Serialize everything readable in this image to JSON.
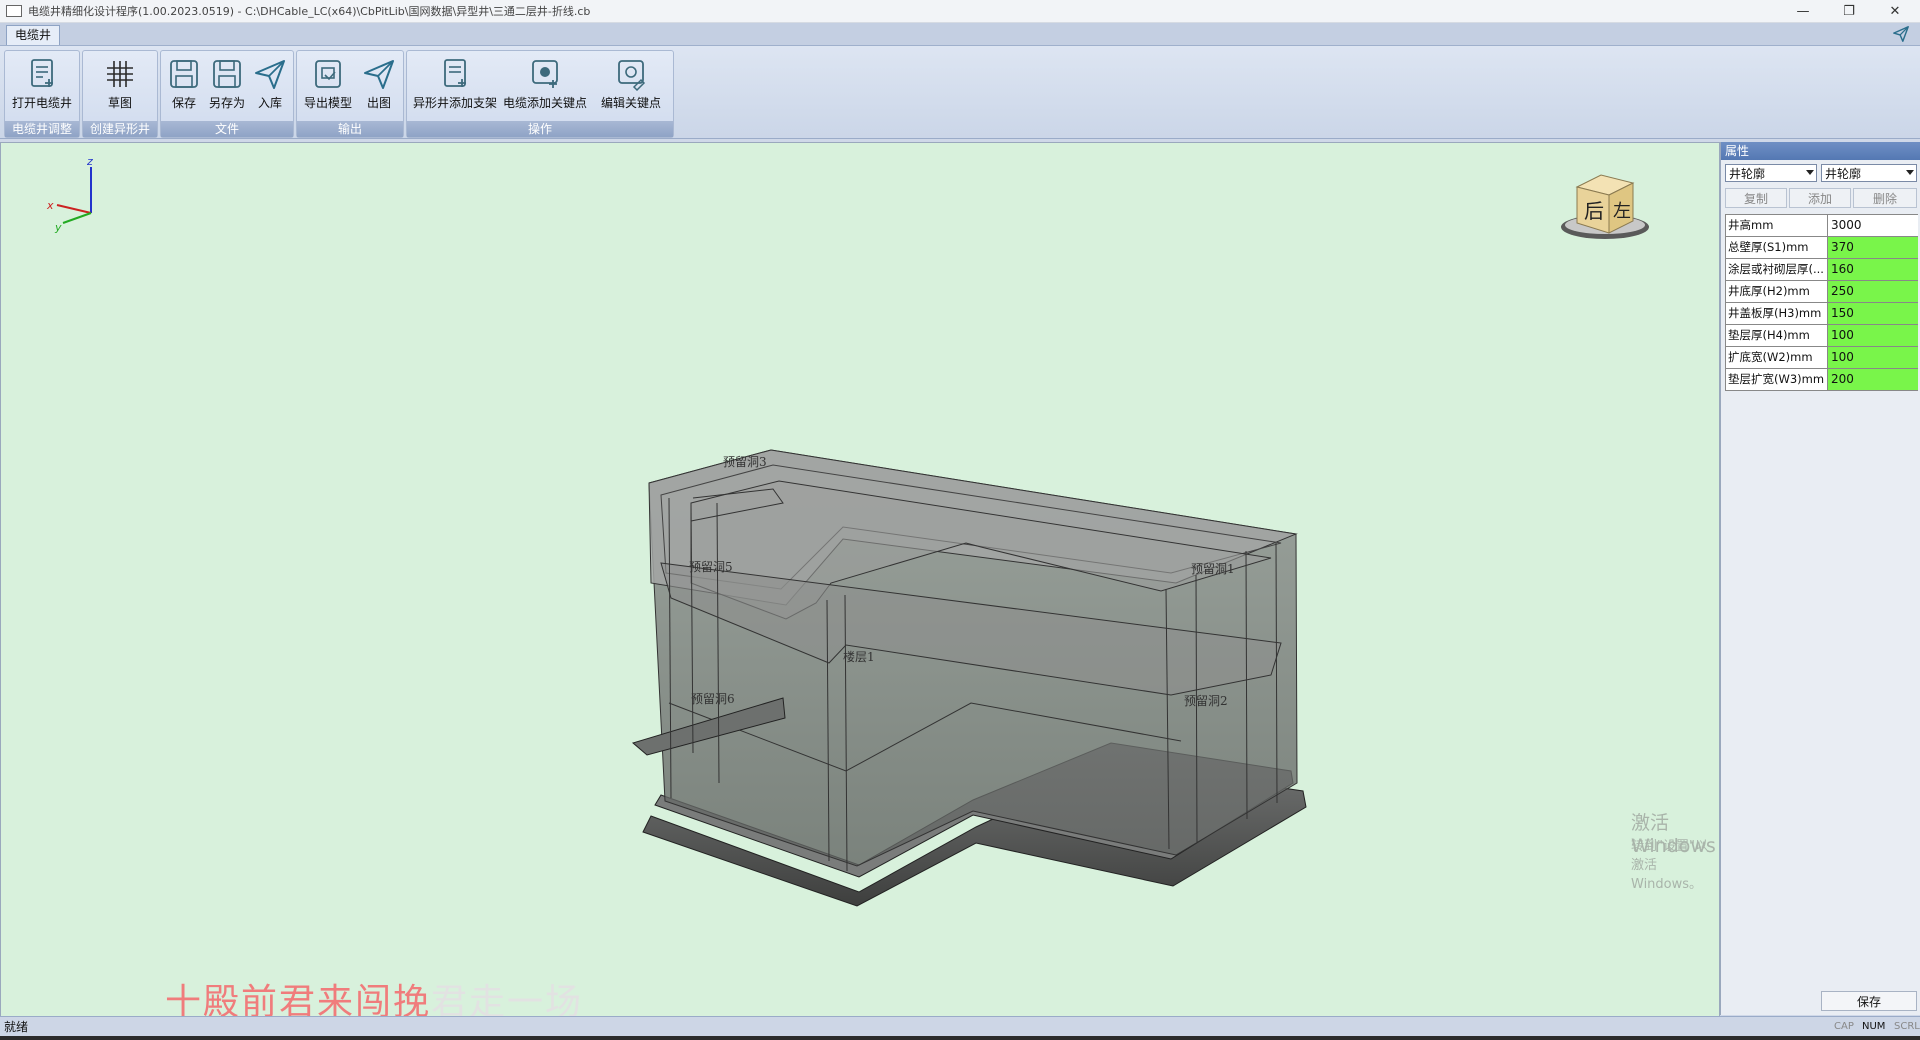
{
  "titlebar": {
    "title": "电缆井精细化设计程序(1.00.2023.0519) - C:\\DHCable_LC(x64)\\CbPitLib\\国网数据\\异型井\\三通二层井-折线.cb",
    "minimize": "—",
    "restore": "❐",
    "close": "✕"
  },
  "ribbon": {
    "tab": "电缆井",
    "groups": [
      {
        "label": "电缆井调整",
        "buttons": [
          {
            "label": "打开电缆井",
            "icon": "open-cable-well-icon"
          }
        ]
      },
      {
        "label": "创建异形井",
        "buttons": [
          {
            "label": "草图",
            "icon": "grid-sketch-icon"
          }
        ]
      },
      {
        "label": "文件",
        "buttons": [
          {
            "label": "保存",
            "icon": "save-icon"
          },
          {
            "label": "另存为",
            "icon": "save-as-icon"
          },
          {
            "label": "入库",
            "icon": "send-icon"
          }
        ]
      },
      {
        "label": "输出",
        "buttons": [
          {
            "label": "导出模型",
            "icon": "export-model-icon"
          },
          {
            "label": "出图",
            "icon": "send-icon"
          }
        ]
      },
      {
        "label": "操作",
        "buttons": [
          {
            "label": "异形井添加支架",
            "icon": "add-bracket-icon"
          },
          {
            "label": "电缆添加关键点",
            "icon": "add-keypoint-icon"
          },
          {
            "label": "编辑关键点",
            "icon": "edit-keypoint-icon"
          }
        ]
      }
    ]
  },
  "viewport": {
    "axes": {
      "x": "x",
      "y": "y",
      "z": "z"
    },
    "viewcube": {
      "back": "后",
      "left": "左"
    },
    "labels": {
      "hole3": "预留洞3",
      "hole5": "预留洞5",
      "hole1": "预留洞1",
      "floor1": "楼层1",
      "hole6": "预留洞6",
      "hole2": "预留洞2"
    },
    "activation": {
      "line1": "激活 Windows",
      "line2": "转到\"设置\"以激活 Windows。"
    },
    "overlay": {
      "part1": "十殿前君来闯挽",
      "part2": "君走一场",
      "color1": "#f07c7c",
      "color2": "#e2e2e2"
    }
  },
  "panel": {
    "title": "属性",
    "combo1": "井轮廓",
    "combo2": "井轮廓",
    "buttons": {
      "copy": "复制",
      "add": "添加",
      "delete": "删除"
    },
    "rows": [
      {
        "key": "井高mm",
        "value": "3000",
        "highlight": false
      },
      {
        "key": "总壁厚(S1)mm",
        "value": "370",
        "highlight": true
      },
      {
        "key": "涂层或衬砌层厚(...",
        "value": "160",
        "highlight": true
      },
      {
        "key": "井底厚(H2)mm",
        "value": "250",
        "highlight": true
      },
      {
        "key": "井盖板厚(H3)mm",
        "value": "150",
        "highlight": true
      },
      {
        "key": "垫层厚(H4)mm",
        "value": "100",
        "highlight": true
      },
      {
        "key": "扩底宽(W2)mm",
        "value": "100",
        "highlight": true
      },
      {
        "key": "垫层扩宽(W3)mm",
        "value": "200",
        "highlight": true
      }
    ],
    "save": "保存"
  },
  "status": {
    "text": "就绪",
    "cap": "CAP",
    "num": "NUM",
    "scrl": "SCRL"
  }
}
